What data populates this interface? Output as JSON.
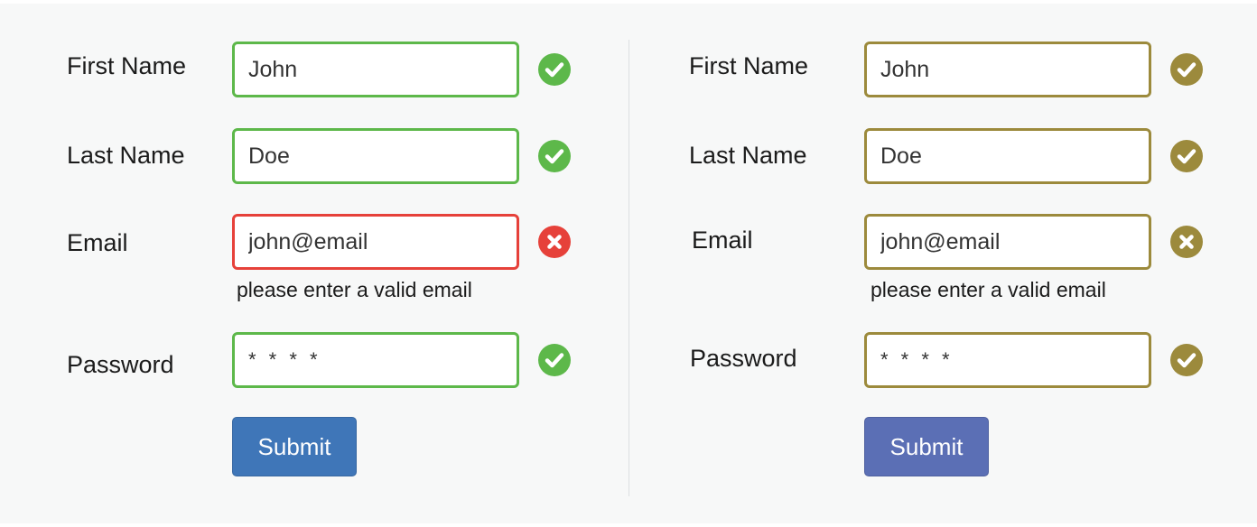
{
  "colors": {
    "left_valid": "#5db84a",
    "left_error": "#e6413a",
    "left_submit": "#3f76b8",
    "right_accent": "#9c8a3c",
    "right_submit": "#5b6fb5"
  },
  "left_form": {
    "first_name_label": "First Name",
    "first_name_value": "John",
    "last_name_label": "Last Name",
    "last_name_value": "Doe",
    "email_label": "Email",
    "email_value": "john@email",
    "email_error": "please enter a valid email",
    "password_label": "Password",
    "password_value": "* * * *",
    "submit_label": "Submit"
  },
  "right_form": {
    "first_name_label": "First Name",
    "first_name_value": "John",
    "last_name_label": "Last Name",
    "last_name_value": "Doe",
    "email_label": "Email",
    "email_value": "john@email",
    "email_error": "please enter a valid email",
    "password_label": "Password",
    "password_value": "* * * *",
    "submit_label": "Submit"
  }
}
